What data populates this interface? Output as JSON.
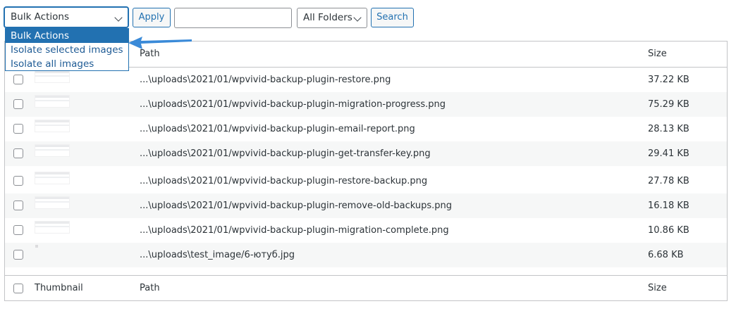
{
  "toolbar": {
    "bulk_selected": "Bulk Actions",
    "apply_label": "Apply",
    "search_value": "",
    "folder_selected": "All Folders",
    "search_label": "Search"
  },
  "dropdown": {
    "options": [
      "Bulk Actions",
      "Isolate selected images",
      "Isolate all images"
    ]
  },
  "table": {
    "columns": {
      "thumbnail": "Thumbnail",
      "path": "Path",
      "size": "Size"
    },
    "rows": [
      {
        "path": "...\\uploads\\2021/01/wpvivid-backup-plugin-restore.png",
        "size": "37.22 KB"
      },
      {
        "path": "...\\uploads\\2021/01/wpvivid-backup-plugin-migration-progress.png",
        "size": "75.29 KB"
      },
      {
        "path": "...\\uploads\\2021/01/wpvivid-backup-plugin-email-report.png",
        "size": "28.13 KB"
      },
      {
        "path": "...\\uploads\\2021/01/wpvivid-backup-plugin-get-transfer-key.png",
        "size": "29.41 KB"
      },
      {
        "path": "...\\uploads\\2021/01/wpvivid-backup-plugin-restore-backup.png",
        "size": "27.78 KB"
      },
      {
        "path": "...\\uploads\\2021/01/wpvivid-backup-plugin-remove-old-backups.png",
        "size": "16.18 KB"
      },
      {
        "path": "...\\uploads\\2021/01/wpvivid-backup-plugin-migration-complete.png",
        "size": "10.86 KB"
      },
      {
        "path": "...\\uploads\\test_image/6-ютуб.jpg",
        "size": "6.68 KB"
      }
    ]
  },
  "colors": {
    "accent": "#2271b1",
    "row_alt": "#f6f7f7",
    "border": "#c3c4c7",
    "arrow": "#3a8ad8"
  }
}
